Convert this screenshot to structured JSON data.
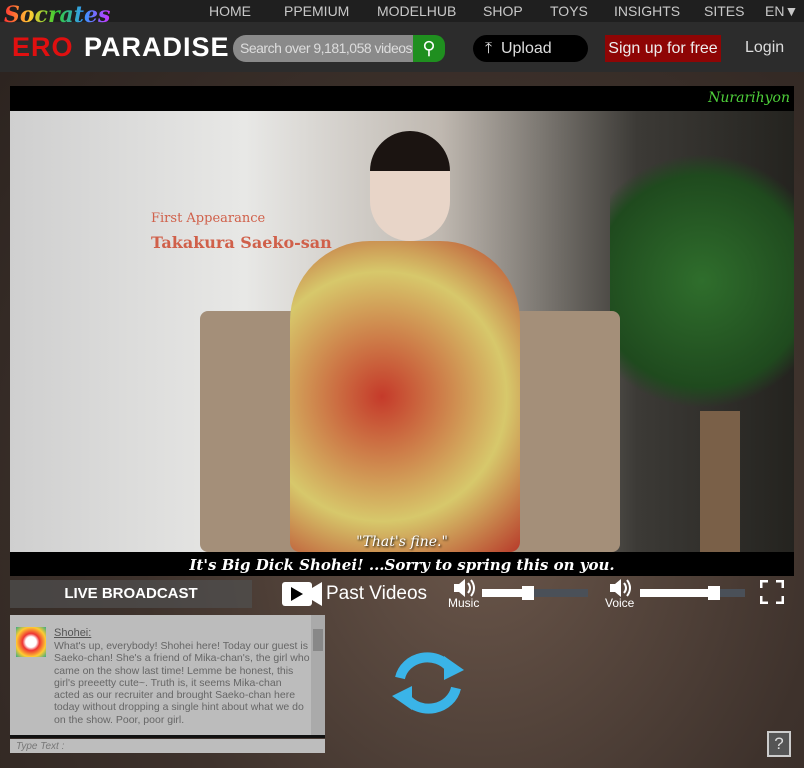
{
  "logo": {
    "top": "Socrates",
    "brand_red": "ERO",
    "brand_white": "PARADISE"
  },
  "nav": [
    "HOME",
    "PPEMIUM",
    "MODELHUB",
    "SHOP",
    "TOYS",
    "INSIGHTS",
    "SITES",
    "EN▼"
  ],
  "search": {
    "placeholder": "Search over 9,181,058 videos",
    "icon": "search-icon"
  },
  "header": {
    "upload": "Upload",
    "signup": "Sign up for free",
    "login": "Login"
  },
  "scene": {
    "watermark": "Nurarihyon",
    "caption_label": "First Appearance",
    "caption_name": "Takakura Saeko-san",
    "spoken": "\"That's fine.\"",
    "subtitle": "It's Big Dick Shohei! ...Sorry to spring this on you."
  },
  "controls": {
    "live": "LIVE BROADCAST",
    "past": "Past Videos",
    "music_label": "Music",
    "music_level": 0.43,
    "voice_label": "Voice",
    "voice_level": 0.7
  },
  "chat": {
    "speaker": "Shohei:",
    "message": "What's up, everybody! Shohei here! Today our guest is Saeko-chan! She's a friend of Mika-chan's, the girl who came on the show last time! Lemme be honest, this girl's preeetty cute~. Truth is, it seems Mika-chan acted as our recruiter and brought Saeko-chan here today without dropping a single hint about what we do on the show. Poor, poor girl.",
    "input_placeholder": "Type Text :"
  },
  "help": "?",
  "colors": {
    "signup": "#8e0505",
    "search_button": "#1f8f1f",
    "reload": "#3ab4e8"
  }
}
